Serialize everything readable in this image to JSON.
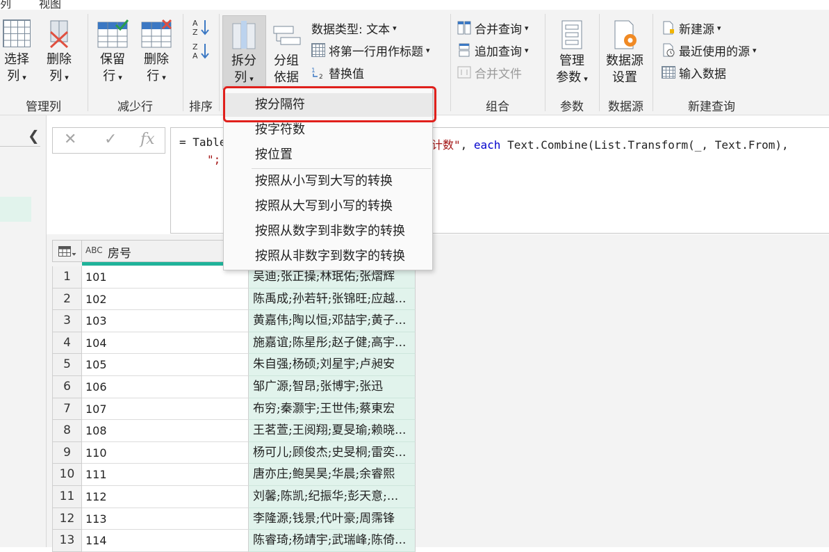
{
  "tabs": [
    "列",
    "视图"
  ],
  "ribbon": {
    "manage_columns": {
      "select_label": "选择",
      "select_label2": "列",
      "remove_label": "删除",
      "remove_label2": "列",
      "group_label": "管理列"
    },
    "reduce_rows": {
      "keep_label": "保留",
      "keep_label2": "行",
      "remove_label": "删除",
      "remove_label2": "行",
      "group_label": "减少行"
    },
    "sort": {
      "group_label": "排序"
    },
    "transform": {
      "split_label": "拆分",
      "split_label2": "列",
      "groupby_label": "分组",
      "groupby_label2": "依据",
      "datatype_label": "数据类型: 文本",
      "first_row_header_label": "将第一行用作标题",
      "replace_values_label": "替换值"
    },
    "combine": {
      "merge_label": "合并查询",
      "append_label": "追加查询",
      "combine_files_label": "合并文件",
      "group_label": "组合"
    },
    "parameters": {
      "manage_label": "管理",
      "manage_label2": "参数",
      "group_label": "参数"
    },
    "datasource": {
      "settings_label": "数据源",
      "settings_label2": "设置",
      "group_label": "数据源"
    },
    "new_query": {
      "new_source_label": "新建源",
      "recent_sources_label": "最近使用的源",
      "enter_data_label": "输入数据",
      "group_label": "新建查询"
    }
  },
  "formula_bar": {
    "cancel_symbol": "✕",
    "confirm_symbol": "✓",
    "fx_label": "fx",
    "line1_pre": "= Table",
    "line1_str": "计数\"",
    "line1_comma": ", ",
    "line1_kw": "each",
    "line1_post": " Text.Combine(List.Transform(_, Text.From),",
    "line2": "\";"
  },
  "dropdown": {
    "items": [
      "按分隔符",
      "按字符数",
      "按位置",
      "按照从小写到大写的转换",
      "按照从大写到小写的转换",
      "按照从数字到非数字的转换",
      "按照从非数字到数字的转换"
    ]
  },
  "table": {
    "header_type_icon": "ABC",
    "header_col1": "房号",
    "rows": [
      {
        "n": "1",
        "room": "101",
        "names": "吴迪;张正操;林珉佑;张熠辉"
      },
      {
        "n": "2",
        "room": "102",
        "names": "陈禹成;孙若轩;张锦旺;应越..."
      },
      {
        "n": "3",
        "room": "103",
        "names": "黄嘉伟;陶以恒;邓喆宇;黄子..."
      },
      {
        "n": "4",
        "room": "104",
        "names": "施嘉谊;陈星彤;赵子健;高宇..."
      },
      {
        "n": "5",
        "room": "105",
        "names": "朱自强;杨硕;刘星宇;卢昶安"
      },
      {
        "n": "6",
        "room": "106",
        "names": "邹广源;智昂;张博宇;张迅"
      },
      {
        "n": "7",
        "room": "107",
        "names": "布穷;秦灏宇;王世伟;蔡東宏"
      },
      {
        "n": "8",
        "room": "108",
        "names": "王茗萱;王阅翔;夏旻瑜;赖晓..."
      },
      {
        "n": "9",
        "room": "110",
        "names": "杨可儿;顾俊杰;史旻桐;雷奕..."
      },
      {
        "n": "10",
        "room": "111",
        "names": "唐亦庄;鲍昊昊;华晨;余睿熙"
      },
      {
        "n": "11",
        "room": "112",
        "names": "刘馨;陈凯;纪振华;彭天意;..."
      },
      {
        "n": "12",
        "room": "113",
        "names": "李隆源;钱景;代叶豪;周霈锋"
      },
      {
        "n": "13",
        "room": "114",
        "names": "陈睿琦;杨靖宇;武瑞峰;陈倚..."
      }
    ]
  },
  "colors": {
    "highlight_box": "#e0201c",
    "quality_bar": "#1fb39a",
    "selected_column": "#e1f3ec"
  }
}
